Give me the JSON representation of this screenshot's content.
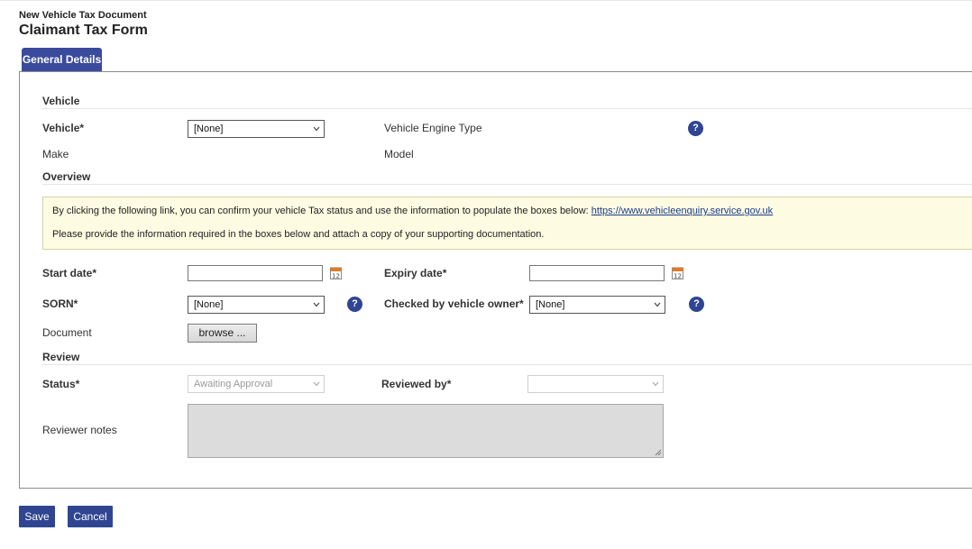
{
  "header": {
    "subtitle": "New Vehicle Tax Document",
    "title": "Claimant Tax Form"
  },
  "tabs": [
    {
      "label": "General Details",
      "active": true
    }
  ],
  "sections": {
    "vehicle": "Vehicle",
    "overview": "Overview",
    "review": "Review"
  },
  "vehicle": {
    "vehicle_label": "Vehicle*",
    "vehicle_value": "[None]",
    "engine_type_label": "Vehicle Engine Type",
    "make_label": "Make",
    "model_label": "Model"
  },
  "overview": {
    "info_text": "By clicking the following link, you can confirm your vehicle Tax status and use the information to populate the boxes below: ",
    "info_link": "https://www.vehicleenquiry.service.gov.uk",
    "info_text_2": "Please provide the information required in the boxes below and attach a copy of your supporting documentation.",
    "start_date_label": "Start date*",
    "start_date_value": "",
    "expiry_date_label": "Expiry date*",
    "expiry_date_value": "",
    "sorn_label": "SORN*",
    "sorn_value": "[None]",
    "checked_label": "Checked by vehicle owner*",
    "checked_value": "[None]",
    "document_label": "Document",
    "browse_label": "browse ..."
  },
  "review": {
    "status_label": "Status*",
    "status_value": "Awaiting Approval",
    "reviewed_by_label": "Reviewed by*",
    "reviewed_by_value": "",
    "notes_label": "Reviewer notes"
  },
  "footer": {
    "save_label": "Save",
    "cancel_label": "Cancel"
  },
  "icons": {
    "help": "?",
    "calendar_day": "12"
  },
  "colors": {
    "accent": "#2f4591",
    "tab": "#3a4a9c",
    "info_bg": "#fdfce2"
  }
}
